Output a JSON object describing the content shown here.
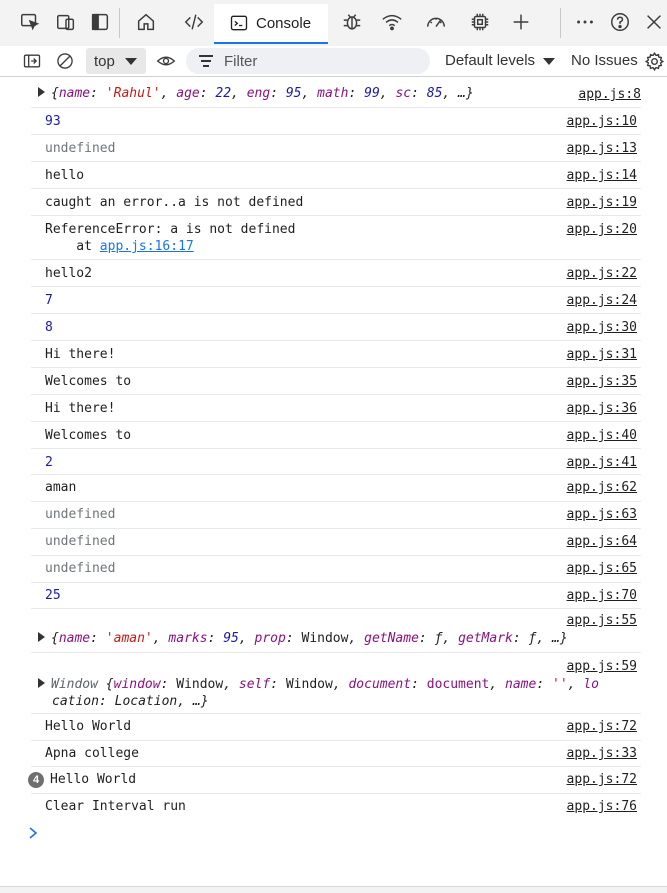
{
  "tabs": {
    "console_label": "Console"
  },
  "toolbar": {
    "context": "top",
    "filter_placeholder": "Filter",
    "levels": "Default levels",
    "issues": "No Issues"
  },
  "log": [
    {
      "msg": "",
      "src": "app.js:8"
    },
    {
      "msg": "93",
      "src": "app.js:10"
    },
    {
      "msg": "undefined",
      "src": "app.js:13"
    },
    {
      "msg": "hello",
      "src": "app.js:14"
    },
    {
      "msg": "caught an error..a is not defined",
      "src": "app.js:19"
    },
    {
      "msg": "ReferenceError: a is not defined",
      "stack_prefix": "    at ",
      "stack_link": "app.js:16:17",
      "src": "app.js:20"
    },
    {
      "msg": "hello2",
      "src": "app.js:22"
    },
    {
      "msg": "7",
      "src": "app.js:24"
    },
    {
      "msg": "8",
      "src": "app.js:30"
    },
    {
      "msg": "Hi there!",
      "src": "app.js:31"
    },
    {
      "msg": "Welcomes to",
      "src": "app.js:35"
    },
    {
      "msg": "Hi there!",
      "src": "app.js:36"
    },
    {
      "msg": "Welcomes to",
      "src": "app.js:40"
    },
    {
      "msg": "2",
      "src": "app.js:41"
    },
    {
      "msg": "aman",
      "src": "app.js:62"
    },
    {
      "msg": "undefined",
      "src": "app.js:63"
    },
    {
      "msg": "undefined",
      "src": "app.js:64"
    },
    {
      "msg": "undefined",
      "src": "app.js:65"
    },
    {
      "msg": "25",
      "src": "app.js:70"
    },
    {
      "msg": "",
      "src": "app.js:55"
    },
    {
      "msg": "",
      "src": "app.js:59"
    },
    {
      "msg": "Hello World",
      "src": "app.js:72"
    },
    {
      "msg": "Apna college",
      "src": "app.js:33"
    },
    {
      "msg": "Hello World",
      "src": "app.js:72",
      "count": "4"
    },
    {
      "msg": "Clear Interval run",
      "src": "app.js:76"
    }
  ],
  "obj1": {
    "name_val": "'Rahul'",
    "age_val": "22",
    "eng_val": "95",
    "math_val": "99",
    "sc_val": "85"
  },
  "obj2": {
    "name_val": "'aman'",
    "marks_val": "95",
    "prop_val": "Window",
    "getName_val": "ƒ",
    "getMark_val": "ƒ"
  },
  "obj3": {
    "label": "Window",
    "window_val": "Window",
    "self_val": "Window",
    "document_val": "document",
    "name_val": "''",
    "line2": "cation: Location, …}"
  },
  "colors": {
    "accent": "#1a73e8",
    "number": "#1a1aa6",
    "key": "#881280",
    "string": "#c41a16"
  }
}
